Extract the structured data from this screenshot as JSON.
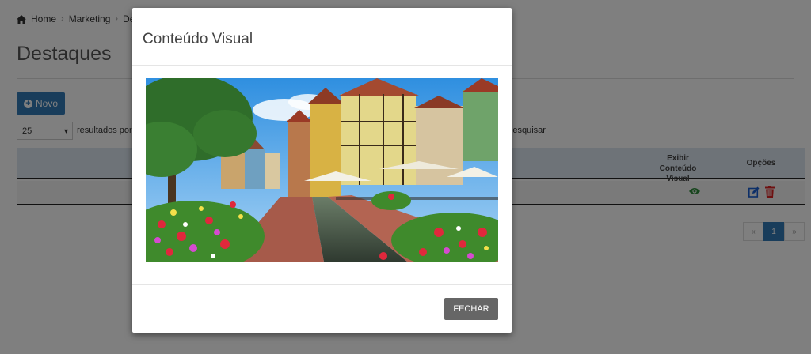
{
  "breadcrumb": {
    "items": [
      "Home",
      "Marketing",
      "Destaques"
    ],
    "icon": "home-icon"
  },
  "page": {
    "title": "Destaques",
    "new_button_label": "Novo"
  },
  "list_controls": {
    "page_size_value": "25",
    "results_label": "resultados por página",
    "search_label": "Pesquisar",
    "search_value": ""
  },
  "table": {
    "columns": [
      "Exibir Conteúdo Visual",
      "Opções"
    ],
    "rows": [
      {
        "view_icon": "eye-icon",
        "actions": [
          "edit-icon",
          "trash-icon"
        ]
      }
    ]
  },
  "pagination": {
    "prev": "«",
    "pages": [
      "1"
    ],
    "current": "1",
    "next": "»"
  },
  "modal": {
    "title": "Conteúdo Visual",
    "close_button_label": "FECHAR",
    "image_subject": "canal com flores e casas enxaimel"
  },
  "colors": {
    "primary": "#337ab7",
    "overlay": "rgba(0,0,0,0.5)",
    "table_header": "#dde6f1",
    "eye": "#2e8b3a",
    "edit": "#1a5fd1",
    "trash": "#d22"
  }
}
